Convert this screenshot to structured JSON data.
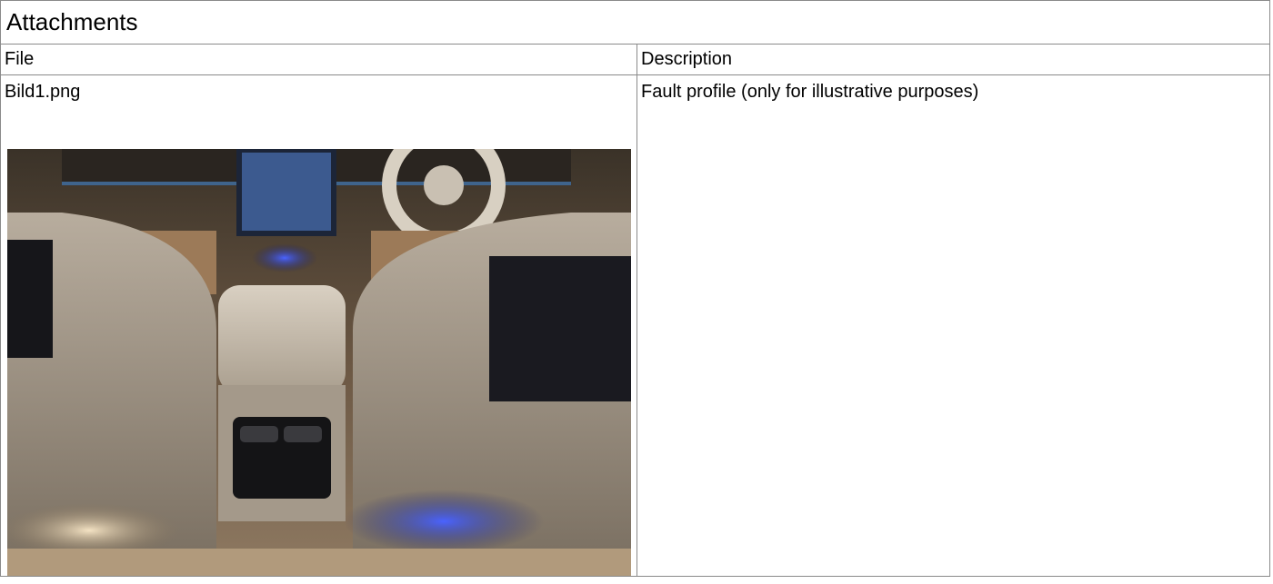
{
  "section": {
    "title": "Attachments"
  },
  "table": {
    "columns": [
      "File",
      "Description"
    ],
    "rows": [
      {
        "file": "Bild1.png",
        "description": "Fault profile (only for illustrative purposes)",
        "thumbnail_icon": "car-interior-photo"
      }
    ]
  }
}
